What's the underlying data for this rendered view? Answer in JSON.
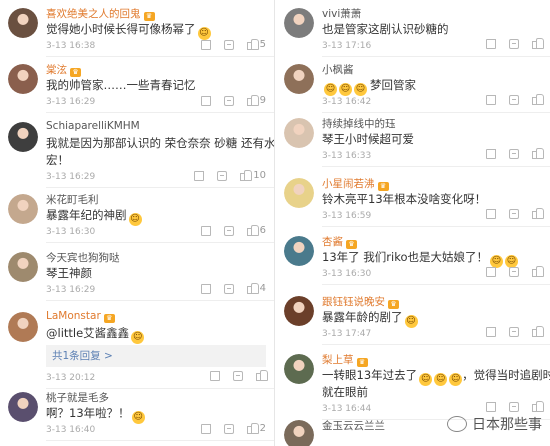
{
  "left": [
    {
      "user": "喜欢绝美之人的回鬼",
      "badge": true,
      "name_color": "#e07a2e",
      "text": "觉得她小时候长得可像杨幂了",
      "emoji": true,
      "time": "3-13 16:38",
      "likes": "5",
      "av": "#6a5040"
    },
    {
      "user": "棠泫",
      "badge": true,
      "name_color": "#e07a2e",
      "text": "我的帅管家……一些青春记忆",
      "emoji": false,
      "time": "3-13 16:29",
      "likes": "9",
      "av": "#8a5f4d"
    },
    {
      "user": "SchiaparelliKMHM",
      "badge": false,
      "name_color": "#555555",
      "text": "我就是因为那部认识的 荣仓奈奈 砂糖 还有水岛",
      "text2": "宏！",
      "emoji": false,
      "time": "3-13 16:29",
      "likes": "10",
      "av": "#3e3e3e"
    },
    {
      "user": "米花町毛利",
      "badge": false,
      "name_color": "#555555",
      "text": "暴露年纪的神剧",
      "emoji": true,
      "time": "3-13 16:30",
      "likes": "6",
      "av": "#c4a88e"
    },
    {
      "user": "今天宾也狗狗哒",
      "badge": false,
      "name_color": "#555555",
      "text": "琴王神颜",
      "emoji": false,
      "time": "3-13 16:29",
      "likes": "4",
      "av": "#9e8a6e"
    },
    {
      "user": "LaMonstar",
      "badge": true,
      "name_color": "#e07a2e",
      "text": "@little艾酱鑫鑫",
      "emoji": true,
      "time": "3-13 20:12",
      "likes": "",
      "av": "#b07a55",
      "replies": "共1条回复 >"
    },
    {
      "user": "桃子就是毛多",
      "badge": false,
      "name_color": "#555555",
      "text": "啊？13年啦？！",
      "emoji": true,
      "time": "3-13 16:40",
      "likes": "2",
      "av": "#5a4f6e"
    }
  ],
  "right": [
    {
      "user": "vivi萧萧",
      "badge": false,
      "name_color": "#555555",
      "text": "也是管家这剧认识砂糖的",
      "emoji": false,
      "time": "3-13 17:16",
      "likes": "",
      "av": "#7c7c7c"
    },
    {
      "user": "小枫酱",
      "badge": false,
      "name_color": "#555555",
      "text": "梦回管家",
      "emoji3": true,
      "time": "3-13 16:42",
      "likes": "",
      "av": "#8e7059"
    },
    {
      "user": "持续掉线中的珏",
      "badge": false,
      "name_color": "#555555",
      "text": "琴王小时候超可爱",
      "emoji": false,
      "time": "3-13 16:33",
      "likes": "",
      "av": "#d9c4b0"
    },
    {
      "user": "小星闹若沸",
      "badge": true,
      "name_color": "#e07a2e",
      "text": "铃木亮平13年根本没啥变化呀！",
      "emoji": false,
      "time": "3-13 16:59",
      "likes": "",
      "av": "#e8d28a"
    },
    {
      "user": "杏酱",
      "badge": true,
      "name_color": "#e07a2e",
      "text": "13年了 我们riko也是大姑娘了！",
      "emoji2": true,
      "time": "3-13 16:30",
      "likes": "",
      "av": "#4a7a8c"
    },
    {
      "user": "跟钰钰说晚安",
      "badge": true,
      "name_color": "#e07a2e",
      "text": "暴露年龄的剧了",
      "emoji": true,
      "time": "3-13 17:47",
      "likes": "",
      "av": "#6b3f2a"
    },
    {
      "user": "梨上草",
      "badge": true,
      "name_color": "#e07a2e",
      "text": "一转眼13年过去了",
      "text_b": "，觉得当时追剧时",
      "text2": "就在眼前",
      "emoji3": true,
      "time": "3-13 16:44",
      "likes": "",
      "av": "#5d6b50"
    },
    {
      "user": "金玉云云兰兰",
      "badge": false,
      "name_color": "#555555",
      "text": "",
      "emoji": false,
      "time": "",
      "likes": "",
      "av": "#7a6a5a"
    }
  ],
  "watermark": "日本那些事",
  "icons": {
    "share": "share-icon",
    "reply": "reply-icon",
    "like": "thumb-up-icon",
    "crown": "vip-crown-icon",
    "emoji": "smiley-emoji-icon"
  }
}
